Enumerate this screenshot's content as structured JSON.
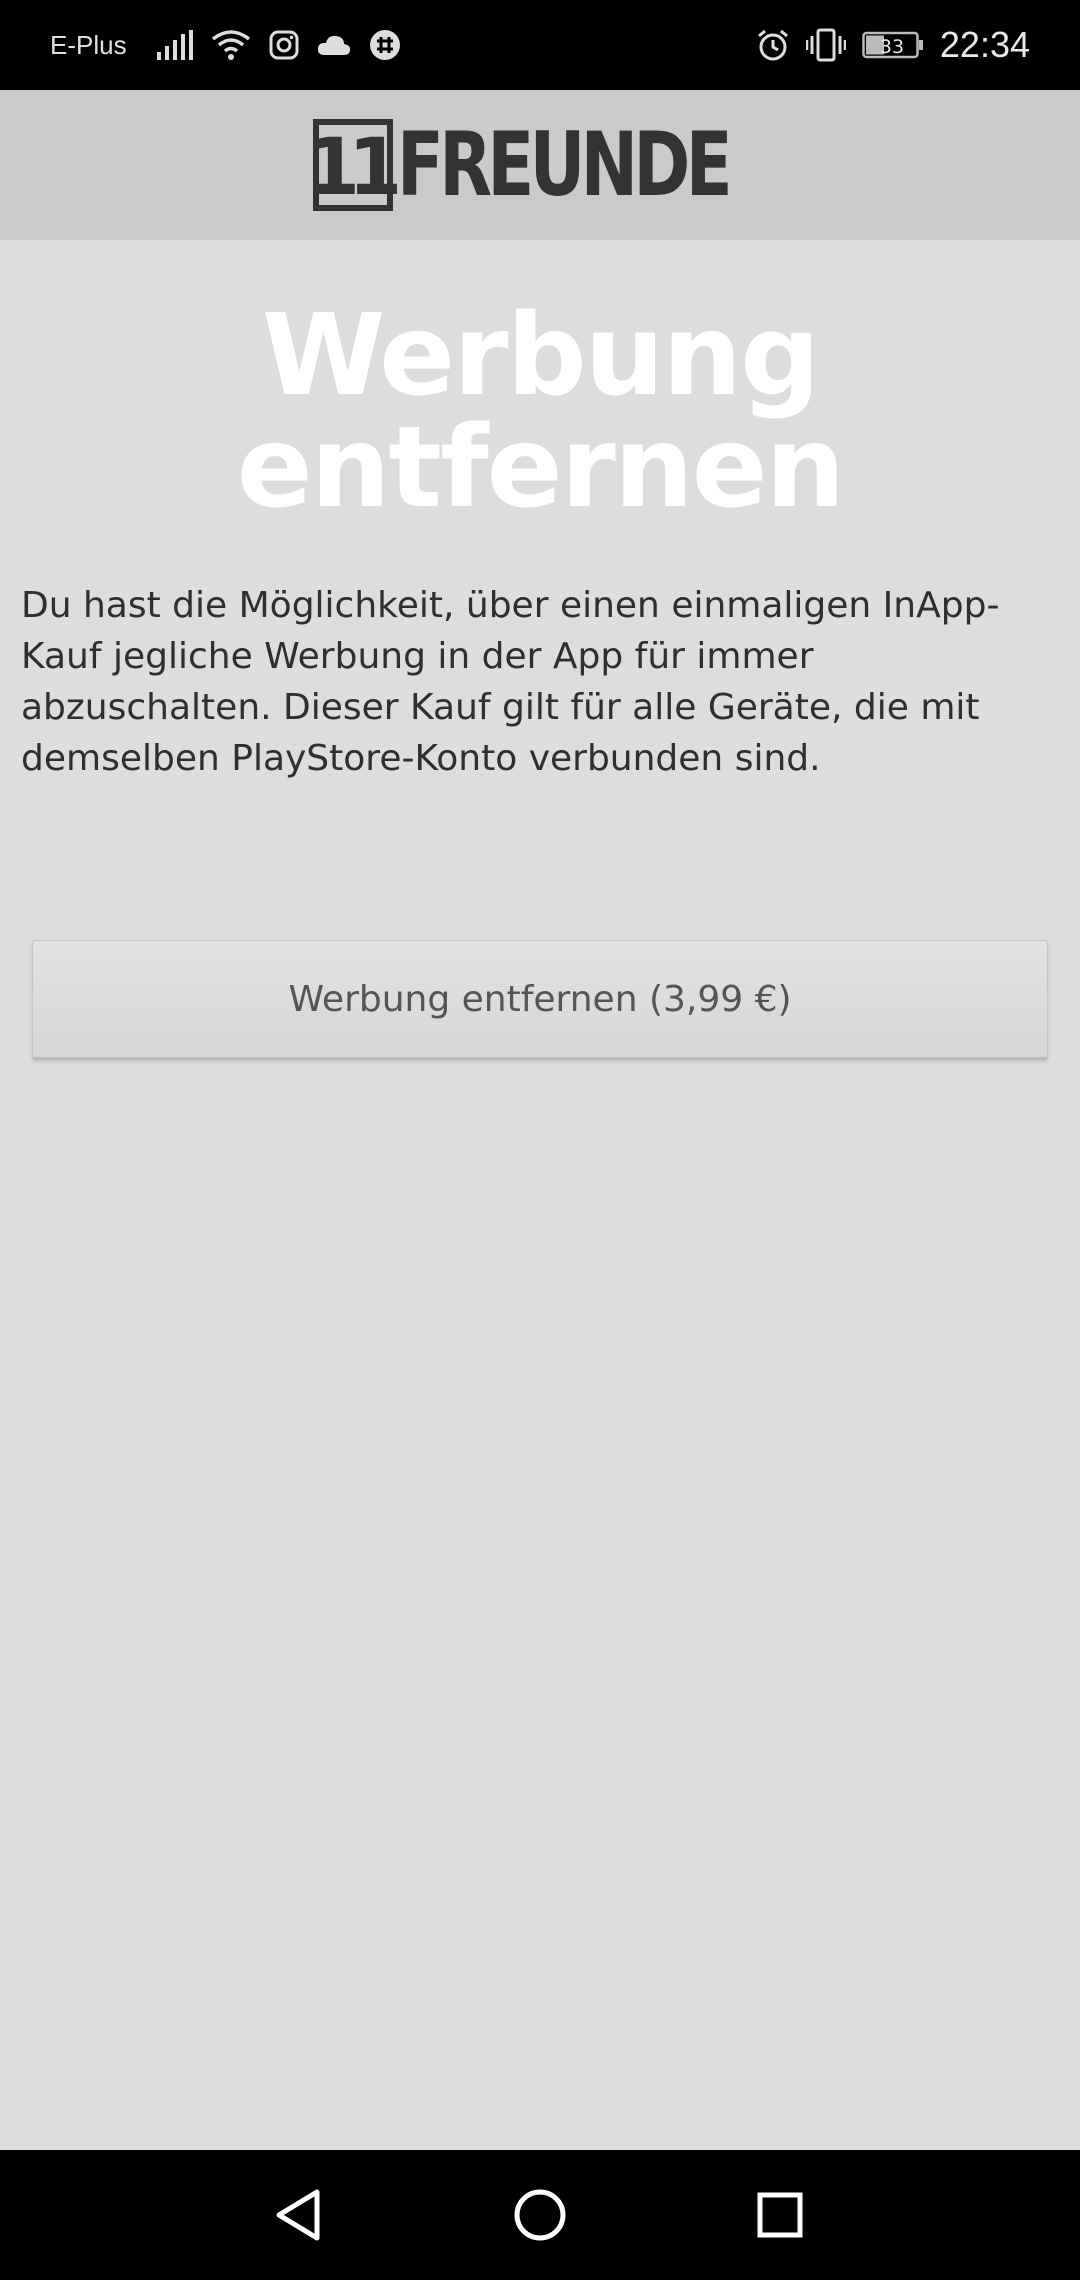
{
  "status_bar": {
    "carrier": "E-Plus",
    "battery": "33",
    "time": "22:34",
    "icons": [
      "signal-icon",
      "wifi-icon",
      "instagram-icon",
      "cloud-icon",
      "slack-icon",
      "alarm-icon",
      "vibrate-icon",
      "battery-icon"
    ]
  },
  "header": {
    "logo_number": "11",
    "logo_text": "FREUNDE"
  },
  "main": {
    "headline": "Werbung entfernen",
    "description": "Du hast die Möglichkeit, über einen einmaligen InApp-Kauf jegliche Werbung in der App für immer abzuschalten. Dieser Kauf gilt für alle Geräte, die mit demselben PlayStore-Konto verbunden sind.",
    "button_label": "Werbung entfernen (3,99 €)"
  },
  "nav_bar": {
    "icons": [
      "back-icon",
      "home-icon",
      "recents-icon"
    ]
  },
  "colors": {
    "background": "#dcdddd",
    "header_bg": "#c9caca",
    "headline": "#ffffff",
    "logo": "#333333"
  }
}
